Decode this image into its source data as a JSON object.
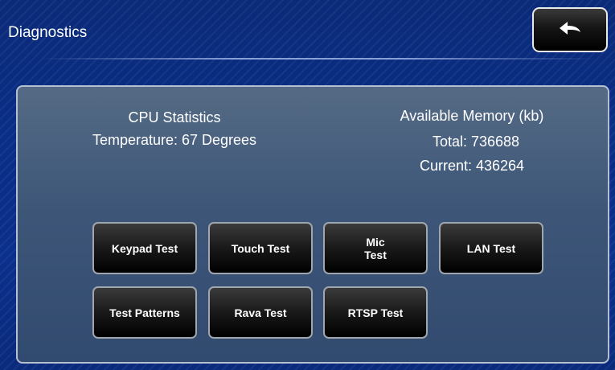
{
  "header": {
    "title": "Diagnostics"
  },
  "cpu": {
    "heading": "CPU Statistics",
    "temperature": "Temperature: 67 Degrees"
  },
  "memory": {
    "heading": "Available Memory (kb)",
    "total": "Total: 736688",
    "current": "Current: 436264"
  },
  "buttons": {
    "keypad": "Keypad Test",
    "touch": "Touch Test",
    "mic_line1": "Mic",
    "mic_line2": "Test",
    "lan": "LAN Test",
    "patterns": "Test Patterns",
    "rava": "Rava Test",
    "rtsp": "RTSP Test"
  },
  "icons": {
    "back": "back-arrow-icon"
  },
  "colors": {
    "background": "#0b2f8c",
    "panel": "#3d5678",
    "button": "#000000"
  }
}
